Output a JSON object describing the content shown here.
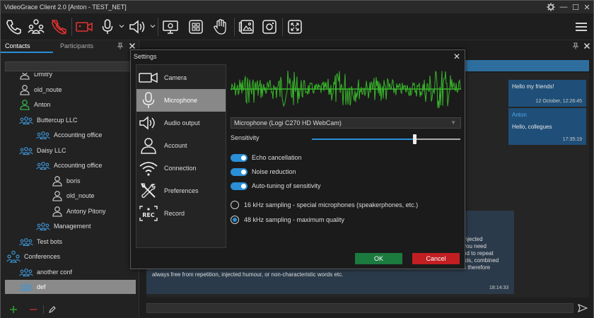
{
  "app": {
    "title": "VideoGrace Client 2.0 [Anton - TEST_NET]"
  },
  "window_controls": {
    "settings_icon": "gear-icon",
    "minimize": "—",
    "maximize": "☐",
    "close": "✕"
  },
  "toolbar": {
    "items": [
      "phone-icon",
      "conference-icon",
      "hangup-icon",
      "camera-icon",
      "microphone-icon",
      "speaker-icon",
      "screen-share-icon",
      "layout-icon",
      "raise-hand-icon",
      "gallery-icon",
      "record-icon",
      "fullscreen-icon",
      "menu-icon"
    ]
  },
  "left_panel": {
    "tabs": {
      "contacts": "Contacts",
      "participants": "Participants"
    },
    "contacts": [
      {
        "label": "Dmitry",
        "icon": "user-icon",
        "level": 1
      },
      {
        "label": "old_noute",
        "icon": "user-icon",
        "level": 1
      },
      {
        "label": "Anton",
        "icon": "user-online-icon",
        "level": 1
      },
      {
        "label": "Buttercup LLC",
        "icon": "group-icon",
        "level": 1
      },
      {
        "label": "Accounting office",
        "icon": "group-icon",
        "level": 2
      },
      {
        "label": "Daisy LLC",
        "icon": "group-icon",
        "level": 1
      },
      {
        "label": "Accounting office",
        "icon": "group-icon",
        "level": 2
      },
      {
        "label": "boris",
        "icon": "user-icon",
        "level": 3
      },
      {
        "label": "old_noute",
        "icon": "user-icon",
        "level": 3
      },
      {
        "label": "Antony Pitony",
        "icon": "user-icon",
        "level": 3
      },
      {
        "label": "Management",
        "icon": "group-icon",
        "level": 2
      },
      {
        "label": "Test bots",
        "icon": "group-icon",
        "level": 1
      },
      {
        "label": "Conferences",
        "icon": "conference-icon",
        "level": 0
      },
      {
        "label": "another conf",
        "icon": "group-icon",
        "level": 1
      },
      {
        "label": "def",
        "icon": "group-icon",
        "level": 1,
        "selected": true
      }
    ]
  },
  "chat": {
    "messages": [
      {
        "text": "Hello my friends!",
        "time": "12 October, 12:26:45"
      },
      {
        "author": "Anton",
        "text": "Hello, collegues",
        "time": "17:35:19"
      }
    ],
    "long_message": {
      "right_fragments": [
        "injected",
        "you need",
        "nd to repeat",
        "rds, combined",
        "s therefore"
      ],
      "last_line": "always free from repetition, injected humour, or non-characteristic words etc.",
      "time": "18:14:33"
    }
  },
  "settings": {
    "title": "Settings",
    "nav": [
      {
        "label": "Camera",
        "icon": "camera-icon"
      },
      {
        "label": "Microphone",
        "icon": "microphone-icon",
        "active": true
      },
      {
        "label": "Audio output",
        "icon": "speaker-icon"
      },
      {
        "label": "Account",
        "icon": "account-icon"
      },
      {
        "label": "Connection",
        "icon": "wifi-icon"
      },
      {
        "label": "Preferences",
        "icon": "tools-icon"
      },
      {
        "label": "Record",
        "icon": "record-icon"
      }
    ],
    "device": "Microphone (Logi C270 HD WebCam)",
    "sensitivity_label": "Sensitivity",
    "sensitivity_value": 0.69,
    "toggles": [
      {
        "label": "Echo cancellation",
        "on": true
      },
      {
        "label": "Noise reduction",
        "on": true
      },
      {
        "label": "Auto-tuning of sensitivity",
        "on": true
      }
    ],
    "sampling": [
      {
        "label": "16 kHz sampling - special microphones (speakerphones, etc.)",
        "selected": false
      },
      {
        "label": "48 kHz sampling - maximum quality",
        "selected": true
      }
    ],
    "ok_label": "OK",
    "cancel_label": "Cancel",
    "colors": {
      "accent": "#2a8fd6",
      "wave": "#38b62a",
      "ok": "#1b7a3e",
      "cancel": "#c21f23"
    }
  }
}
